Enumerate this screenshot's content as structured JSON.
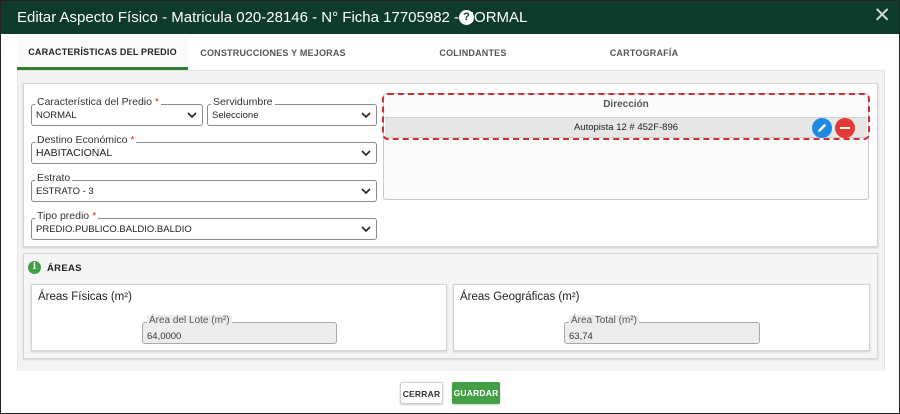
{
  "dialog": {
    "title": "Editar Aspecto Físico - Matricula 020-28146 - N° Ficha 17705982 - NORMAL",
    "help_glyph": "?",
    "close_glyph": "✕"
  },
  "tabs": [
    {
      "label": "CARACTERÍSTICAS DEL PREDIO",
      "active": true
    },
    {
      "label": "CONSTRUCCIONES Y MEJORAS",
      "active": false
    },
    {
      "label": "COLINDANTES",
      "active": false
    },
    {
      "label": "CARTOGRAFÍA",
      "active": false
    }
  ],
  "form": {
    "caracteristica": {
      "label": "Característica del Predio",
      "required": "*",
      "value": "NORMAL"
    },
    "servidumbre": {
      "label": "Servidumbre",
      "value": "Seleccione"
    },
    "destino": {
      "label": "Destino Económico",
      "required": "*",
      "value": "HABITACIONAL"
    },
    "estrato": {
      "label": "Estrato",
      "value": "ESTRATO - 3"
    },
    "tipo_predio": {
      "label": "Tipo predio",
      "required": "*",
      "value": "PREDIO.PUBLICO.BALDIO.BALDIO"
    }
  },
  "direccion": {
    "header": "Dirección",
    "rows": [
      {
        "value": "Autopista 12 # 452F-896"
      }
    ],
    "edit_icon": "pencil-icon",
    "remove_icon": "minus-icon",
    "edit_color": "#1e88e5",
    "remove_color": "#e53935",
    "highlight_color": "#d32f2f"
  },
  "areas": {
    "title": "ÁREAS",
    "info_glyph": "i",
    "fisicas": {
      "title": "Áreas Físicas (m²)",
      "field_label": "Área del Lote (m²)",
      "field_value": "64,0000"
    },
    "geograficas": {
      "title": "Áreas Geográficas (m²)",
      "field_label": "Área Total (m²)",
      "field_value": "63,74"
    }
  },
  "footer": {
    "cancel_label": "CERRAR",
    "save_label": "GUARDAR"
  },
  "colors": {
    "titlebar": "#0f3b2c",
    "accent_green": "#43a047",
    "tab_indicator": "#2e7d32"
  }
}
